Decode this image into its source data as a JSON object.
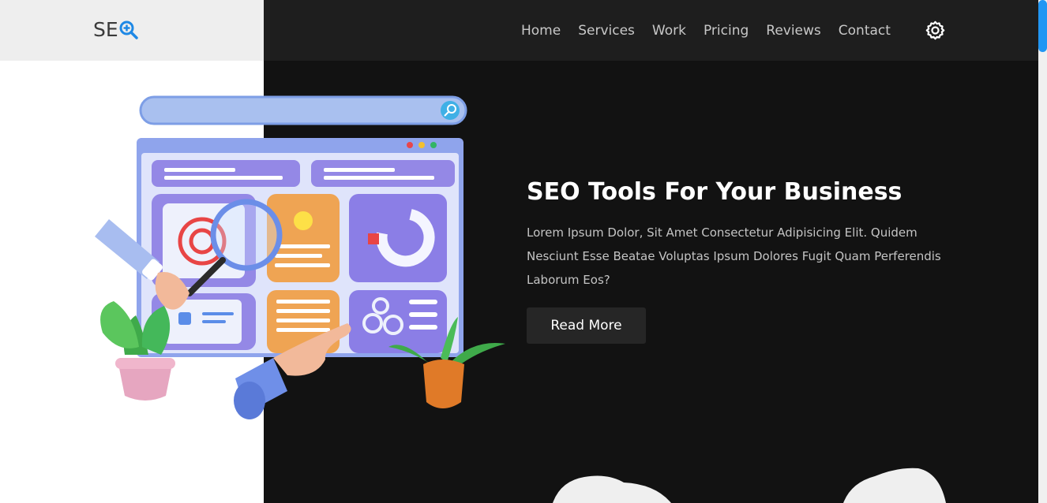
{
  "logo": {
    "text": "SE",
    "icon": "search-plus-icon"
  },
  "nav": {
    "items": [
      "Home",
      "Services",
      "Work",
      "Pricing",
      "Reviews",
      "Contact"
    ],
    "settings_icon": "gear-icon"
  },
  "hero": {
    "title": "SEO Tools For Your Business",
    "description": "Lorem Ipsum Dolor, Sit Amet Consectetur Adipisicing Elit. Quidem Nesciunt Esse Beatae Voluptas Ipsum Dolores Fugit Quam Perferendis Laborum Eos?",
    "button_label": "Read More"
  },
  "colors": {
    "accent": "#1e88e5",
    "dark_bg": "#121212",
    "nav_bg": "#1e1e1e",
    "logo_bg": "#eeeeee",
    "button_bg": "#262626"
  }
}
